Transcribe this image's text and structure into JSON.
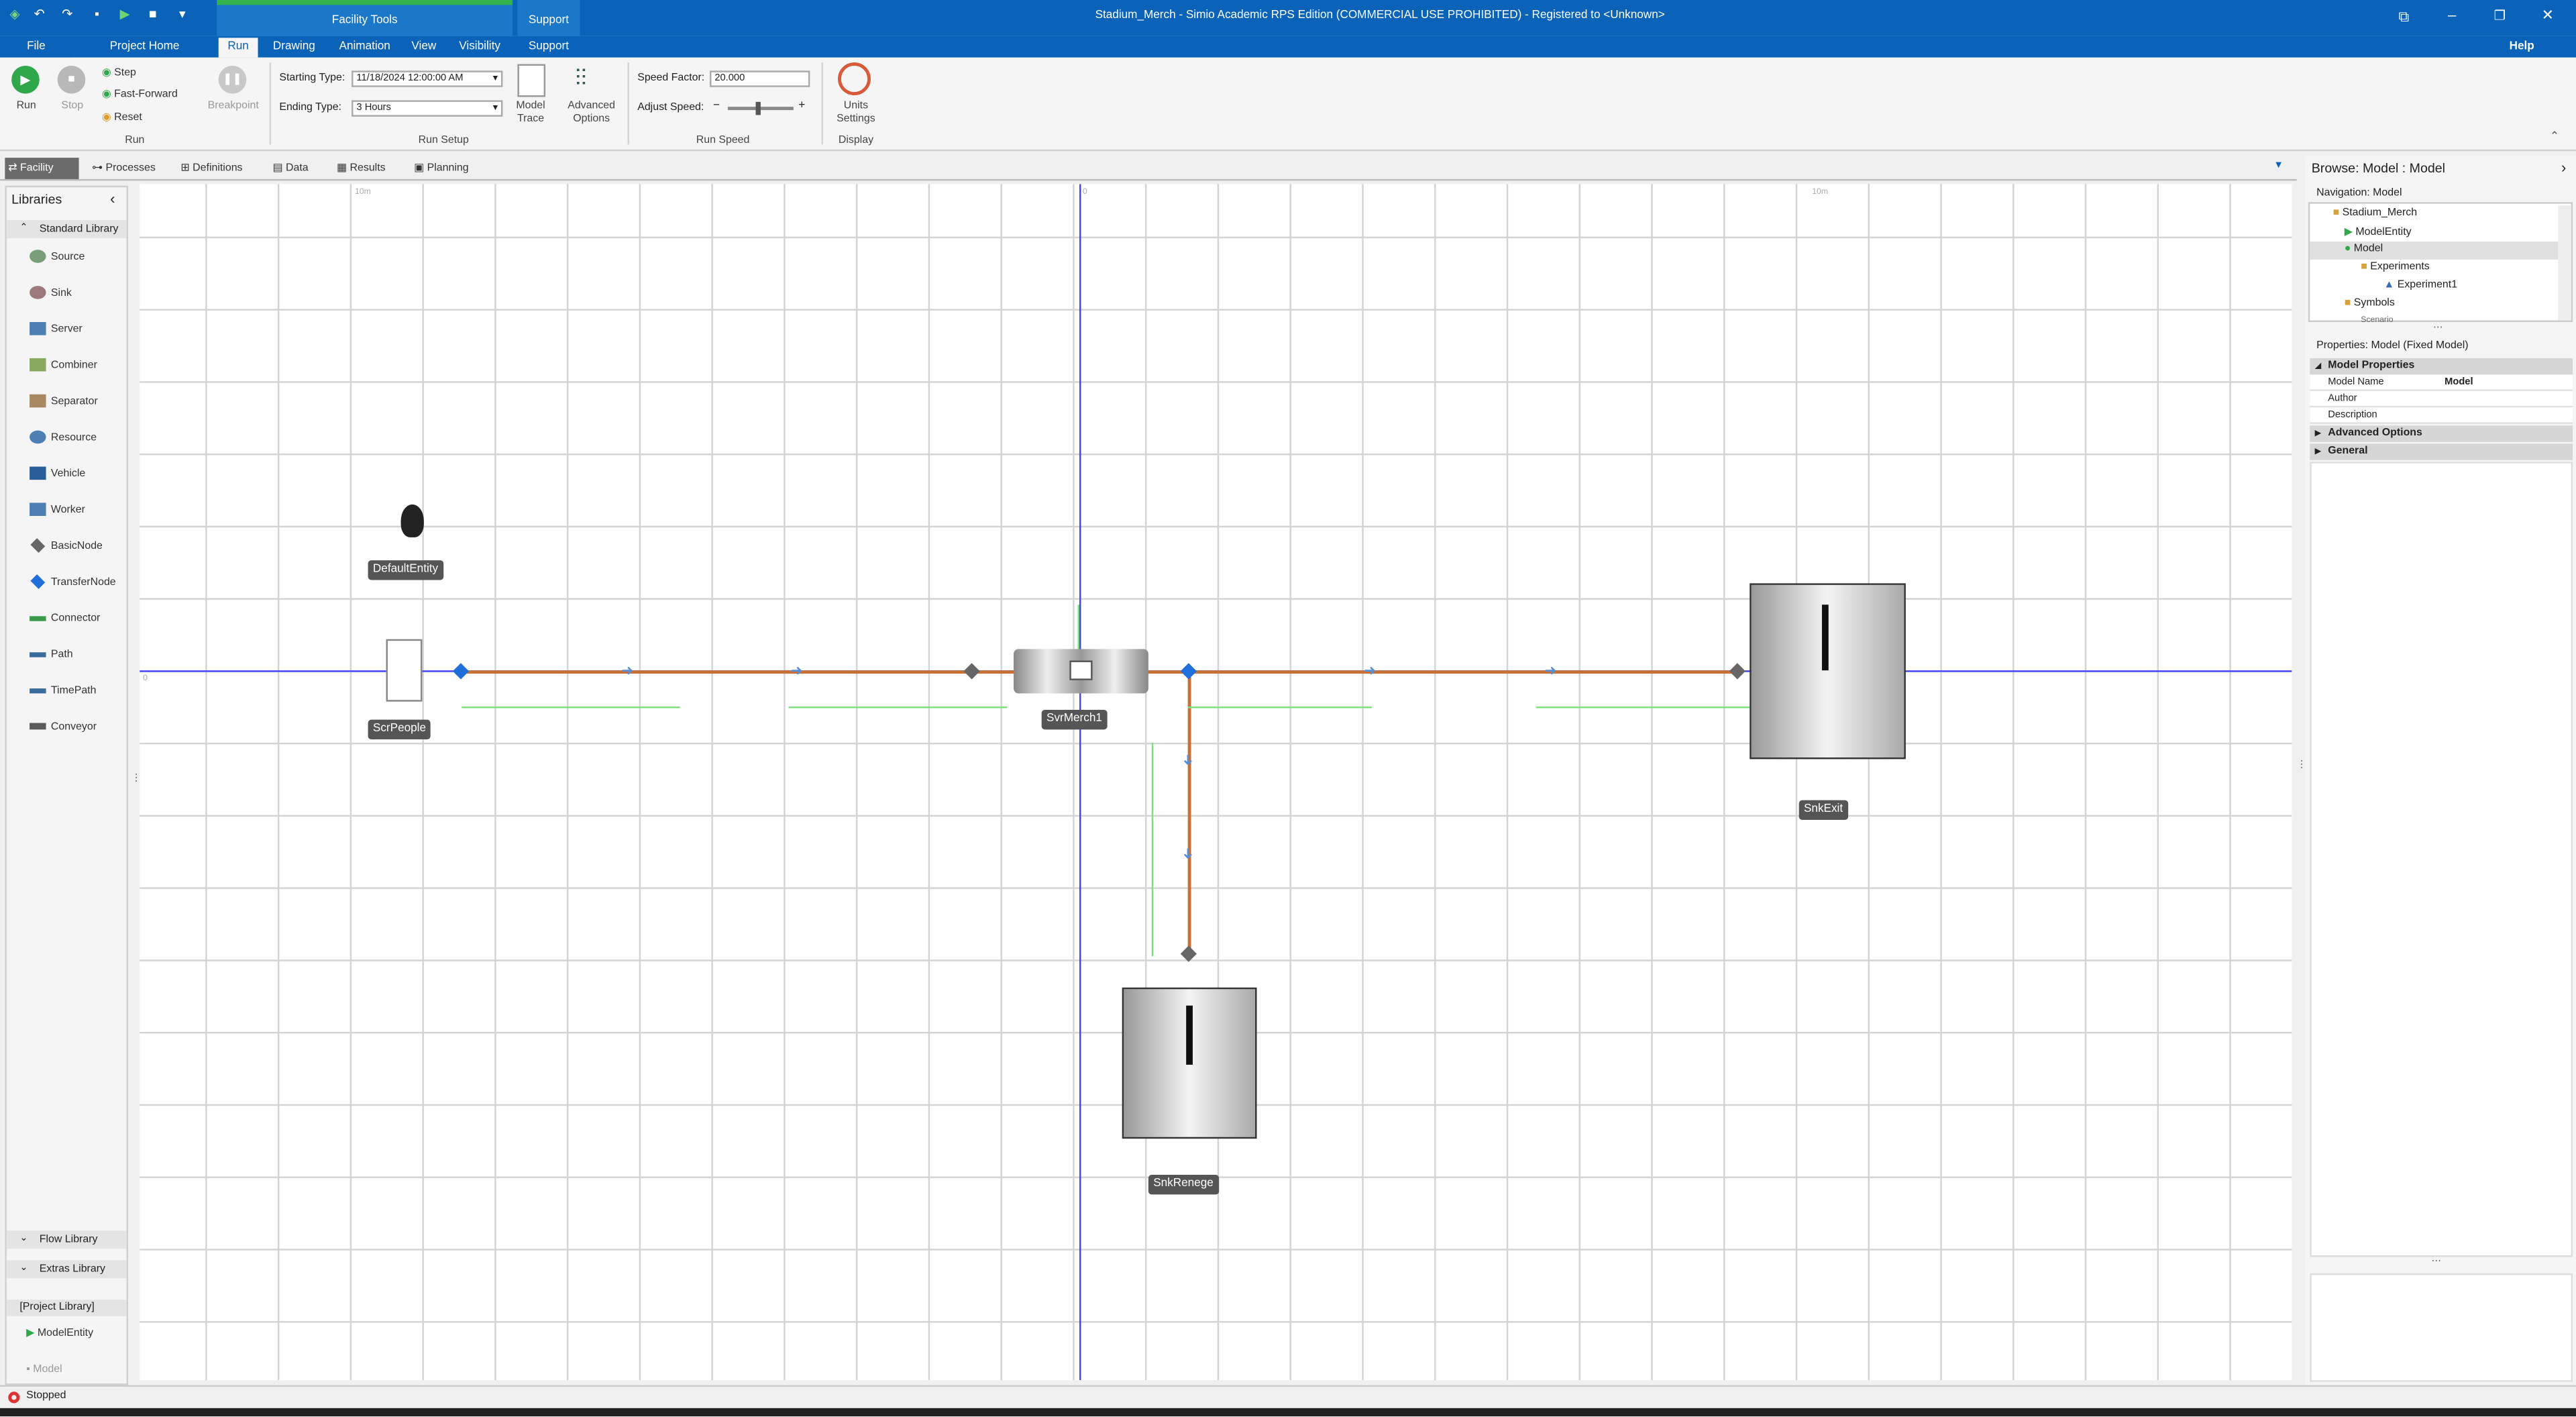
{
  "window": {
    "title": "Stadium_Merch - Simio Academic RPS Edition (COMMERCIAL USE PROHIBITED) - Registered to <Unknown>"
  },
  "context_tabs": {
    "facility_tools": "Facility Tools",
    "support": "Support"
  },
  "ribbon_tabs": {
    "file": "File",
    "project_home": "Project Home",
    "run": "Run",
    "drawing": "Drawing",
    "animation": "Animation",
    "view": "View",
    "visibility": "Visibility",
    "support": "Support"
  },
  "help": "Help",
  "run_group": {
    "run": "Run",
    "stop": "Stop",
    "step": "Step",
    "fast_forward": "Fast-Forward",
    "reset": "Reset",
    "breakpoint": "Breakpoint",
    "label": "Run"
  },
  "run_setup": {
    "starting_type_label": "Starting Type:",
    "starting_type_value": "11/18/2024 12:00:00 AM",
    "ending_type_label": "Ending Type:",
    "ending_type_value": "3 Hours",
    "model_trace": "Model Trace",
    "advanced_options": "Advanced Options",
    "label": "Run Setup"
  },
  "run_speed": {
    "speed_factor_label": "Speed Factor:",
    "speed_factor_value": "20.000",
    "adjust_speed_label": "Adjust Speed:",
    "minus": "−",
    "plus": "+",
    "label": "Run Speed"
  },
  "display": {
    "units_settings": "Units Settings",
    "label": "Display"
  },
  "doc_tabs": {
    "facility": "Facility",
    "processes": "Processes",
    "definitions": "Definitions",
    "data": "Data",
    "results": "Results",
    "planning": "Planning"
  },
  "libraries": {
    "title": "Libraries",
    "standard_library": "Standard Library",
    "items": [
      "Source",
      "Sink",
      "Server",
      "Combiner",
      "Separator",
      "Resource",
      "Vehicle",
      "Worker",
      "BasicNode",
      "TransferNode",
      "Connector",
      "Path",
      "TimePath",
      "Conveyor"
    ],
    "flow_library": "Flow Library",
    "extras_library": "Extras Library",
    "project_library": "[Project Library]",
    "project_items": [
      "ModelEntity",
      "Model"
    ]
  },
  "canvas": {
    "ruler_left": "10m",
    "ruler_mid": "0",
    "ruler_right": "10m",
    "ruler_side": "0",
    "default_entity": "DefaultEntity",
    "source": "ScrPeople",
    "server": "SvrMerch1",
    "sink_exit": "SnkExit",
    "sink_renege": "SnkRenege"
  },
  "browse": {
    "title": "Browse: Model : Model",
    "navigation_label": "Navigation: Model",
    "tree": [
      "Stadium_Merch",
      "ModelEntity",
      "Model",
      "Experiments",
      "Experiment1",
      "Symbols",
      "Scenario"
    ]
  },
  "properties": {
    "title": "Properties: Model (Fixed Model)",
    "section": "Model Properties",
    "rows": [
      {
        "name": "Model Name",
        "value": "Model"
      },
      {
        "name": "Author",
        "value": ""
      },
      {
        "name": "Description",
        "value": ""
      }
    ],
    "advanced": "Advanced Options",
    "general": "General"
  },
  "status": {
    "text": "Stopped"
  },
  "colors": {
    "accent": "#0a63b8",
    "ruler": "#4444ff",
    "path": "#c87137",
    "link_green": "#7ce07c"
  }
}
